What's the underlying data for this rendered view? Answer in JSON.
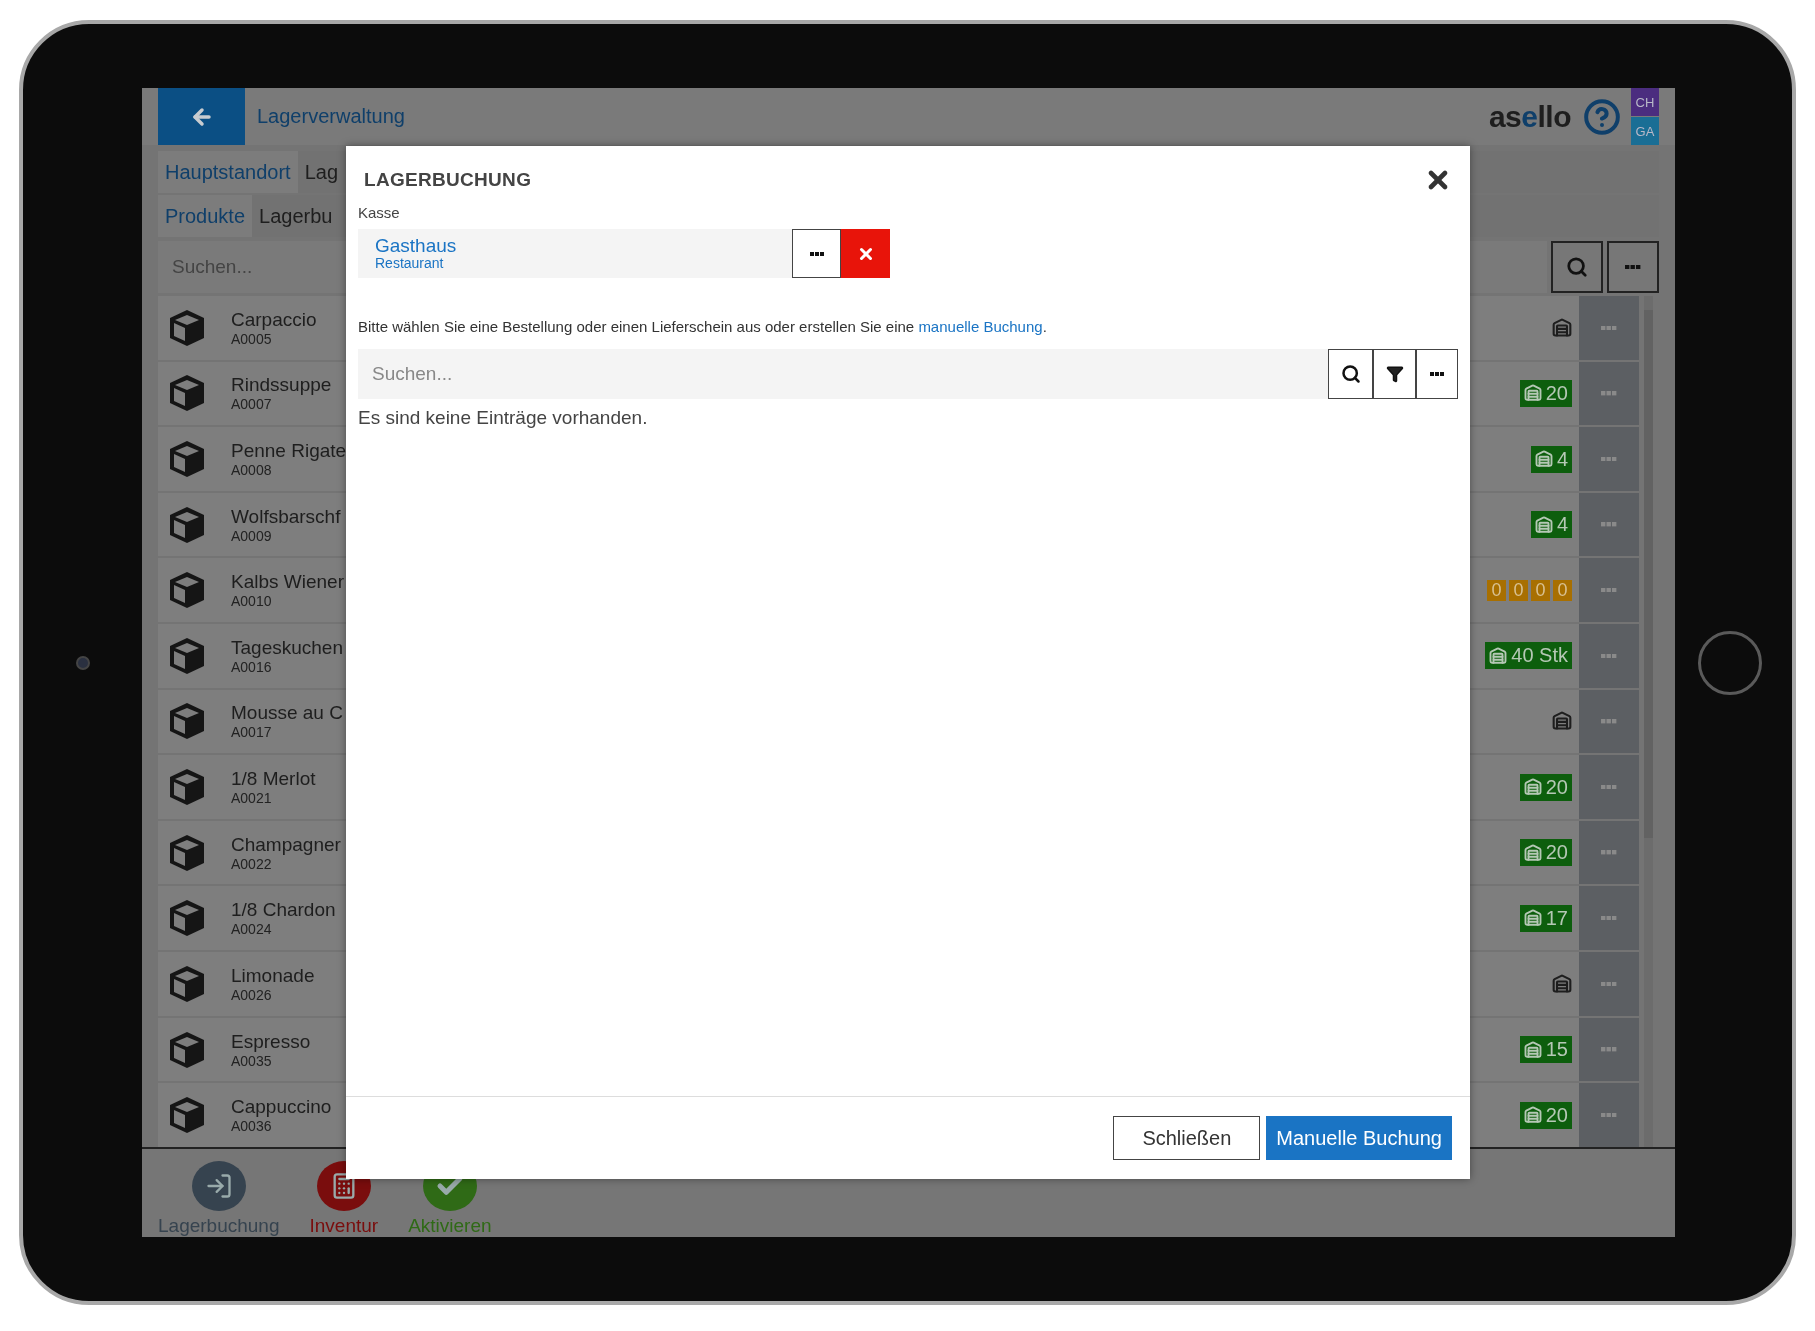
{
  "header": {
    "title": "Lagerverwaltung",
    "logo": "asello",
    "user_badges": [
      {
        "label": "CH",
        "color": "#4b2d7f"
      },
      {
        "label": "GA",
        "color": "#1a6e95"
      }
    ]
  },
  "location_tabs": [
    {
      "label": "Hauptstandort",
      "selected": true
    },
    {
      "label": "Lag",
      "selected": false
    }
  ],
  "view_tabs": [
    {
      "label": "Produkte",
      "selected": true
    },
    {
      "label": "Lagerbu",
      "selected": false
    }
  ],
  "search": {
    "placeholder": "Suchen..."
  },
  "products": [
    {
      "name": "Carpaccio",
      "code": "A0005",
      "stock": {
        "kind": "icon"
      }
    },
    {
      "name": "Rindssuppe",
      "code": "A0007",
      "stock": {
        "kind": "count",
        "value": "20"
      }
    },
    {
      "name": "Penne Rigate",
      "code": "A0008",
      "stock": {
        "kind": "count",
        "value": "4"
      }
    },
    {
      "name": "Wolfsbarschf",
      "code": "A0009",
      "stock": {
        "kind": "count",
        "value": "4"
      }
    },
    {
      "name": "Kalbs Wiener",
      "code": "A0010",
      "stock": {
        "kind": "digits",
        "digits": [
          "0",
          "0",
          "0",
          "0"
        ]
      }
    },
    {
      "name": "Tageskuchen",
      "code": "A0016",
      "stock": {
        "kind": "count",
        "value": "40 Stk"
      }
    },
    {
      "name": "Mousse au C",
      "code": "A0017",
      "stock": {
        "kind": "icon"
      }
    },
    {
      "name": "1/8 Merlot",
      "code": "A0021",
      "stock": {
        "kind": "count",
        "value": "20"
      }
    },
    {
      "name": "Champagner",
      "code": "A0022",
      "stock": {
        "kind": "count",
        "value": "20"
      }
    },
    {
      "name": "1/8 Chardon",
      "code": "A0024",
      "stock": {
        "kind": "count",
        "value": "17"
      }
    },
    {
      "name": "Limonade",
      "code": "A0026",
      "stock": {
        "kind": "icon"
      }
    },
    {
      "name": "Espresso",
      "code": "A0035",
      "stock": {
        "kind": "count",
        "value": "15"
      }
    },
    {
      "name": "Cappuccino",
      "code": "A0036",
      "stock": {
        "kind": "count",
        "value": "20"
      }
    }
  ],
  "toolbar": [
    {
      "label": "Lagerbuchung",
      "kind": "booking",
      "color": "#36434f"
    },
    {
      "label": "Inventur",
      "kind": "inventory",
      "color": "#7a0d0d"
    },
    {
      "label": "Aktivieren",
      "kind": "activate",
      "color": "#2f6a16"
    }
  ],
  "modal": {
    "title": "LAGERBUCHUNG",
    "field_label": "Kasse",
    "register": {
      "name": "Gasthaus",
      "type": "Restaurant"
    },
    "hint": "Bitte wählen Sie eine Bestellung oder einen Lieferschein aus oder erstellen Sie eine ",
    "hint_link": "manuelle Buchung",
    "hint_end": ".",
    "search": {
      "placeholder": "Suchen..."
    },
    "empty_message": "Es sind keine Einträge vorhanden.",
    "buttons": [
      {
        "label": "Schließen",
        "primary": false
      },
      {
        "label": "Manuelle Buchung",
        "primary": true
      }
    ]
  }
}
